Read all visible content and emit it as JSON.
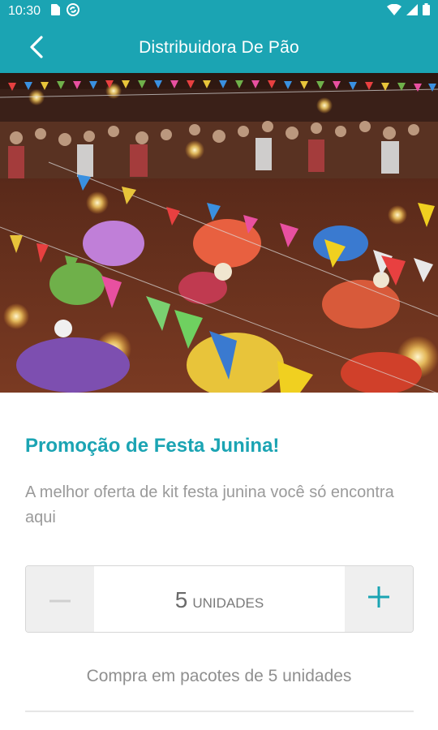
{
  "status_bar": {
    "time": "10:30"
  },
  "app_bar": {
    "title": "Distribuidora De Pão"
  },
  "promo": {
    "title": "Promoção de Festa Junina!",
    "description": "A melhor oferta de kit festa junina você só encontra aqui"
  },
  "stepper": {
    "quantity": "5",
    "unit_label": "UNIDADES",
    "decrement_symbol": "−",
    "increment_symbol": "+"
  },
  "pack_note": "Compra em pacotes de 5 unidades",
  "colors": {
    "accent": "#1ba4b3",
    "muted_text": "#9a9a9a"
  },
  "hero_image": {
    "icon": "festa-junina-photo"
  }
}
